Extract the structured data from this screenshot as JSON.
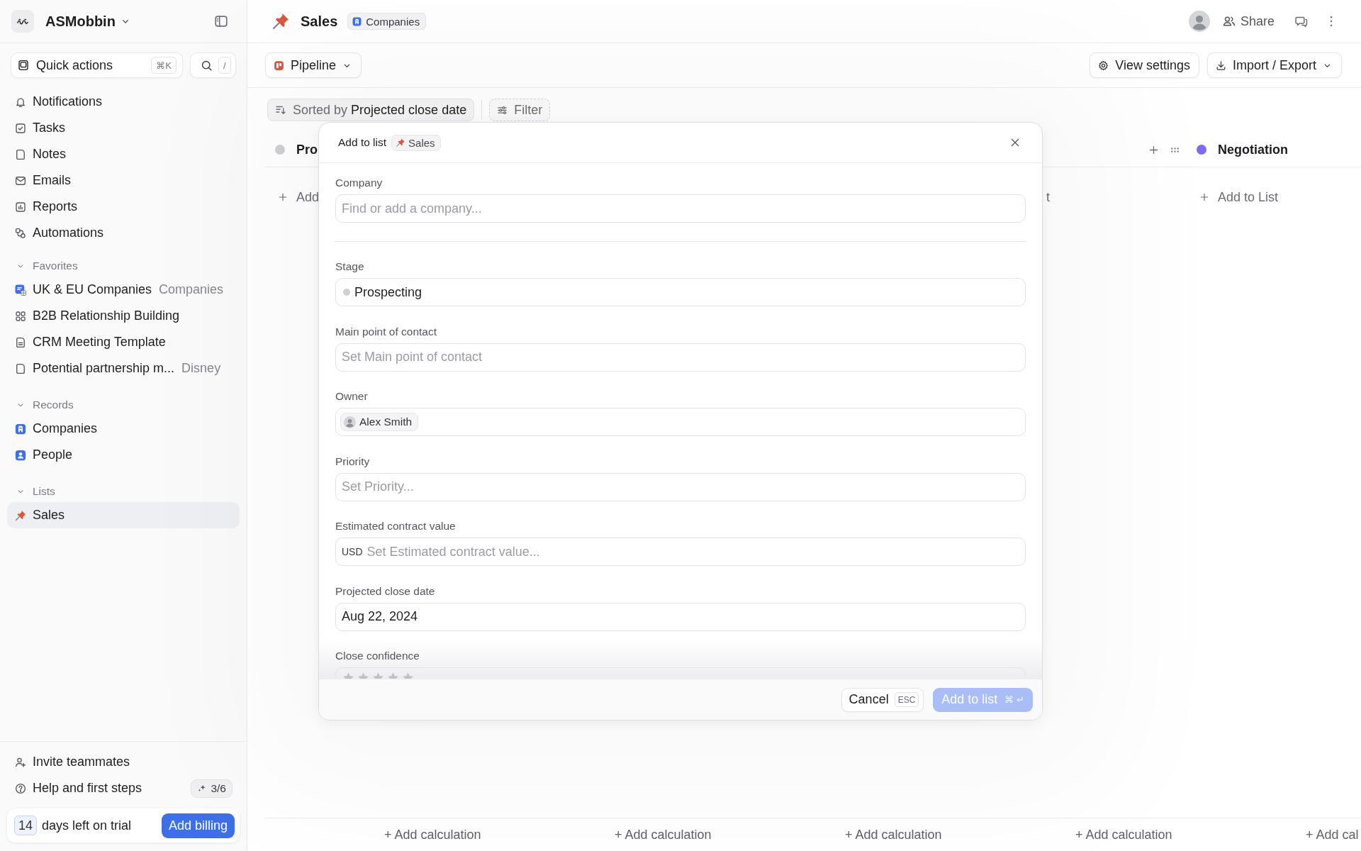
{
  "sidebar": {
    "workspace": "ASMobbin",
    "quick_actions": {
      "label": "Quick actions",
      "shortcut": "⌘K"
    },
    "search_shortcut": "/",
    "nav": [
      {
        "label": "Notifications",
        "selected": false
      },
      {
        "label": "Tasks",
        "selected": false
      },
      {
        "label": "Notes",
        "selected": false
      },
      {
        "label": "Emails",
        "selected": false
      },
      {
        "label": "Reports",
        "selected": false
      },
      {
        "label": "Automations",
        "selected": false
      }
    ],
    "sections": [
      {
        "title": "Favorites",
        "expanded": true,
        "items": [
          {
            "label": "UK & EU Companies",
            "detail": "Companies",
            "selected": false
          },
          {
            "label": "B2B Relationship Building",
            "selected": false
          },
          {
            "label": "CRM Meeting Template",
            "selected": false
          },
          {
            "label": "Potential partnership m...",
            "detail": "Disney",
            "selected": false
          }
        ]
      },
      {
        "title": "Records",
        "expanded": true,
        "items": [
          {
            "label": "Companies",
            "selected": false
          },
          {
            "label": "People",
            "selected": false
          }
        ]
      },
      {
        "title": "Lists",
        "expanded": true,
        "items": [
          {
            "label": "Sales",
            "selected": true
          }
        ]
      }
    ],
    "footer": {
      "invite": "Invite teammates",
      "help": {
        "label": "Help and first steps",
        "progress": "3/6"
      },
      "trial": {
        "days": "14",
        "text": "days left on trial",
        "button": "Add billing"
      }
    }
  },
  "header": {
    "title": "Sales",
    "object": "Companies",
    "share": "Share"
  },
  "toolbar": {
    "view": "Pipeline",
    "view_settings": "View settings",
    "import_export": "Import / Export"
  },
  "filters": {
    "sort_label": "Sorted by",
    "sort_field": "Projected close date",
    "filter": "Filter"
  },
  "board": {
    "columns": [
      {
        "kind": "full",
        "title": "Pro",
        "color": "#cfd0d3",
        "add_label": "Add"
      },
      {
        "kind": "covered",
        "hovered": true,
        "add_label": "t"
      },
      {
        "kind": "full",
        "title": "Negotiation",
        "color": "#7b6cf0",
        "add_label": "Add to List"
      }
    ],
    "calculations": [
      "+ Add calculation",
      "+ Add calculation",
      "+ Add calculation",
      "+ Add calculation",
      "+ Add cal"
    ]
  },
  "modal": {
    "title": "Add to list",
    "list": "Sales",
    "fields": [
      {
        "label": "Company",
        "kind": "record",
        "placeholder": "Find or add a company..."
      },
      {
        "label": "Stage",
        "kind": "status",
        "value": "Prospecting"
      },
      {
        "label": "Main point of contact",
        "kind": "text",
        "placeholder": "Set Main point of contact"
      },
      {
        "label": "Owner",
        "kind": "person",
        "value": "Alex Smith"
      },
      {
        "label": "Priority",
        "kind": "text",
        "placeholder": "Set Priority..."
      },
      {
        "label": "Estimated contract value",
        "kind": "currency",
        "currency": "USD",
        "placeholder": "Set Estimated contract value..."
      },
      {
        "label": "Projected close date",
        "kind": "text",
        "value": "Aug 22, 2024"
      },
      {
        "label": "Close confidence",
        "kind": "rating",
        "stars": 0
      }
    ],
    "cancel": {
      "label": "Cancel",
      "shortcut": "ESC"
    },
    "submit": {
      "label": "Add to list",
      "shortcut": "⌘ ↵",
      "disabled": true
    }
  }
}
